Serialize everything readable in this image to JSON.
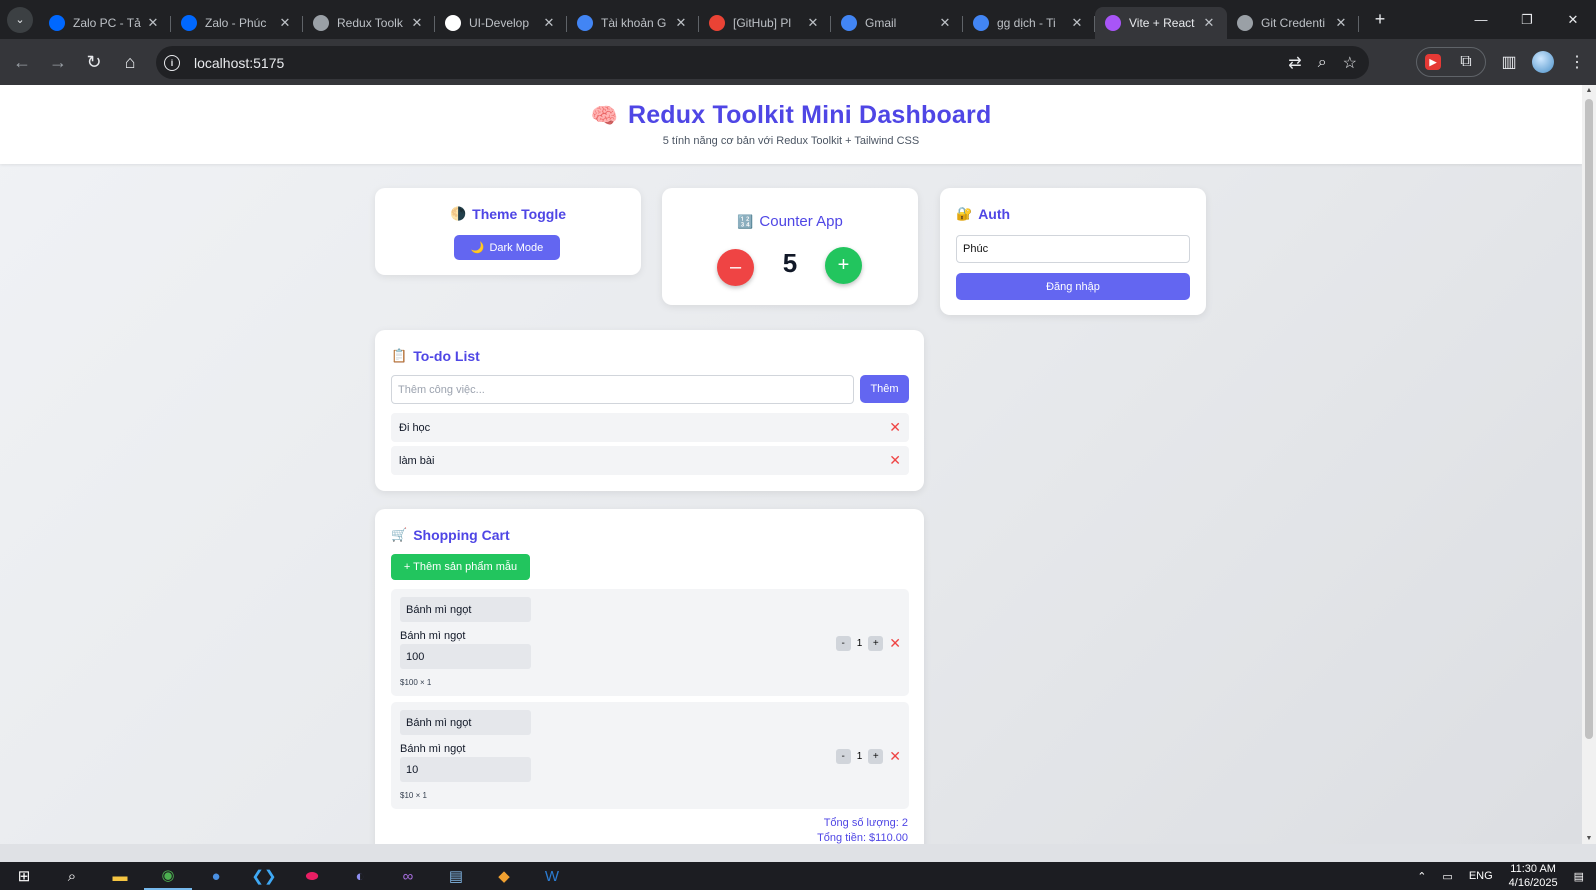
{
  "browser": {
    "tabs": [
      {
        "title": "Zalo PC - Tả",
        "favicon": "zalo-icon",
        "color": "#0068ff"
      },
      {
        "title": "Zalo - Phúc",
        "favicon": "zalo-icon",
        "color": "#0068ff"
      },
      {
        "title": "Redux Toolk",
        "favicon": "openai-icon",
        "color": "#9aa0a6"
      },
      {
        "title": "UI-Develop",
        "favicon": "github-icon",
        "color": "#ffffff"
      },
      {
        "title": "Tài khoản G",
        "favicon": "google-icon",
        "color": "#4285f4"
      },
      {
        "title": "[GitHub] Pl",
        "favicon": "gmail-icon",
        "color": "#ea4335"
      },
      {
        "title": "Gmail",
        "favicon": "google-icon",
        "color": "#4285f4"
      },
      {
        "title": "gg dịch - Ti",
        "favicon": "google-icon",
        "color": "#4285f4"
      },
      {
        "title": "Vite + React",
        "favicon": "vite-icon",
        "color": "#a855f7",
        "active": true
      },
      {
        "title": "Git Credenti",
        "favicon": "globe-icon",
        "color": "#9aa0a6"
      }
    ],
    "url": "localhost:5175"
  },
  "header": {
    "title": "Redux Toolkit Mini Dashboard",
    "title_emoji": "🧠",
    "subtitle": "5 tính năng cơ bản với Redux Toolkit + Tailwind CSS"
  },
  "theme": {
    "emoji": "🌗",
    "title": "Theme Toggle",
    "button_emoji": "🌙",
    "button_label": "Dark Mode"
  },
  "counter": {
    "emoji": "🔢",
    "title": "Counter App",
    "decrement_label": "–",
    "increment_label": "+",
    "value": "5"
  },
  "auth": {
    "emoji": "🔐",
    "title": "Auth",
    "username_value": "Phúc",
    "login_label": "Đăng nhập"
  },
  "todo": {
    "emoji": "📋",
    "title": "To-do List",
    "input_placeholder": "Thêm công việc...",
    "add_label": "Thêm",
    "items": [
      {
        "label": "Đi học"
      },
      {
        "label": "làm bài"
      }
    ]
  },
  "cart": {
    "emoji": "🛒",
    "title": "Shopping Cart",
    "add_sample_label": "+ Thêm sản phẩm mẫu",
    "items": [
      {
        "name_field": "Bánh mì ngọt",
        "name_label": "Bánh mì ngọt",
        "price_field": "100",
        "subtotal": "$100 × 1",
        "quantity": "1"
      },
      {
        "name_field": "Bánh mì ngọt",
        "name_label": "Bánh mì ngọt",
        "price_field": "10",
        "subtotal": "$10 × 1",
        "quantity": "1"
      }
    ],
    "qty_minus": "-",
    "qty_plus": "+",
    "total_quantity": "Tổng số lượng: 2",
    "total_price": "Tổng tiền: $110.00"
  },
  "taskbar": {
    "language": "ENG",
    "time": "11:30 AM",
    "date": "4/16/2025"
  },
  "colors": {
    "accent": "#4f46e5",
    "button": "#6366f1",
    "danger": "#ef4444",
    "success": "#22c55e"
  }
}
